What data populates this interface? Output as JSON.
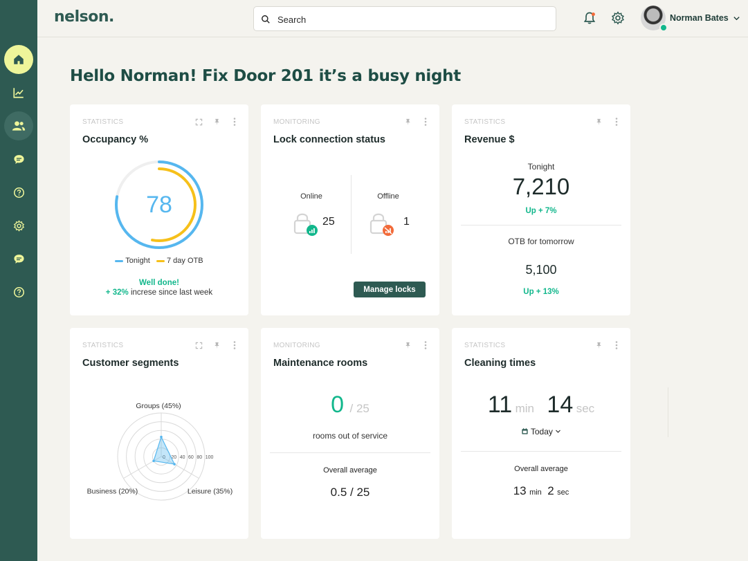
{
  "app": {
    "logo": "nelson."
  },
  "search": {
    "placeholder": "Search"
  },
  "user": {
    "name": "Norman Bates"
  },
  "greeting": "Hello Norman! Fix Door 201 it’s a busy night",
  "sidebar": {
    "items": [
      {
        "icon": "home-icon",
        "active": true
      },
      {
        "icon": "chart-icon"
      },
      {
        "icon": "users-icon"
      },
      {
        "icon": "chat-icon"
      },
      {
        "icon": "help-icon"
      },
      {
        "icon": "gear-icon"
      },
      {
        "icon": "chat-icon"
      },
      {
        "icon": "help-icon"
      }
    ]
  },
  "colors": {
    "accent": "#2e5a52",
    "highlight": "#eef59a",
    "tonight": "#56b7ef",
    "otb": "#f6c01a",
    "positive": "#12b78c",
    "offline": "#f26b3a"
  },
  "occupancy": {
    "kicker": "STATISTICS",
    "title": "Occupancy %",
    "value": "78",
    "tonight_fraction": 0.78,
    "otb_fraction": 0.53,
    "legend_tonight": "Tonight",
    "legend_otb": "7 day OTB",
    "message": "Well done!",
    "change": "+ 32%",
    "change_text": "increse since last week"
  },
  "locks": {
    "kicker": "MONITORING",
    "title": "Lock connection status",
    "online_label": "Online",
    "online_count": "25",
    "offline_label": "Offline",
    "offline_count": "1",
    "button": "Manage locks"
  },
  "revenue": {
    "kicker": "STATISTICS",
    "title": "Revenue $",
    "tonight_label": "Tonight",
    "tonight_value": "7,210",
    "tonight_change": "Up + 7%",
    "otb_label": "OTB for tomorrow",
    "otb_value": "5,100",
    "otb_change": "Up + 13%"
  },
  "segments": {
    "kicker": "STATISTICS",
    "title": "Customer segments"
  },
  "maintenance": {
    "kicker": "MONITORING",
    "title": "Maintenance rooms",
    "count": "0",
    "total": "/ 25",
    "caption": "rooms out of service",
    "avg_label": "Overall average",
    "avg_value": "0.5 / 25"
  },
  "cleaning": {
    "kicker": "STATISTICS",
    "title": "Cleaning times",
    "min": "11",
    "min_unit": "min",
    "sec": "14",
    "sec_unit": "sec",
    "period": "Today",
    "avg_label": "Overall average",
    "avg_min": "13",
    "avg_min_unit": "min",
    "avg_sec": "2",
    "avg_sec_unit": "sec"
  },
  "chart_data": {
    "type": "radar",
    "categories": [
      "Groups (45%)",
      "Leisure (35%)",
      "Business (20%)"
    ],
    "values": [
      45,
      35,
      20
    ],
    "tick_labels": [
      "0",
      "20",
      "40",
      "60",
      "80",
      "100"
    ],
    "ylim": [
      0,
      100
    ],
    "grid": true
  }
}
